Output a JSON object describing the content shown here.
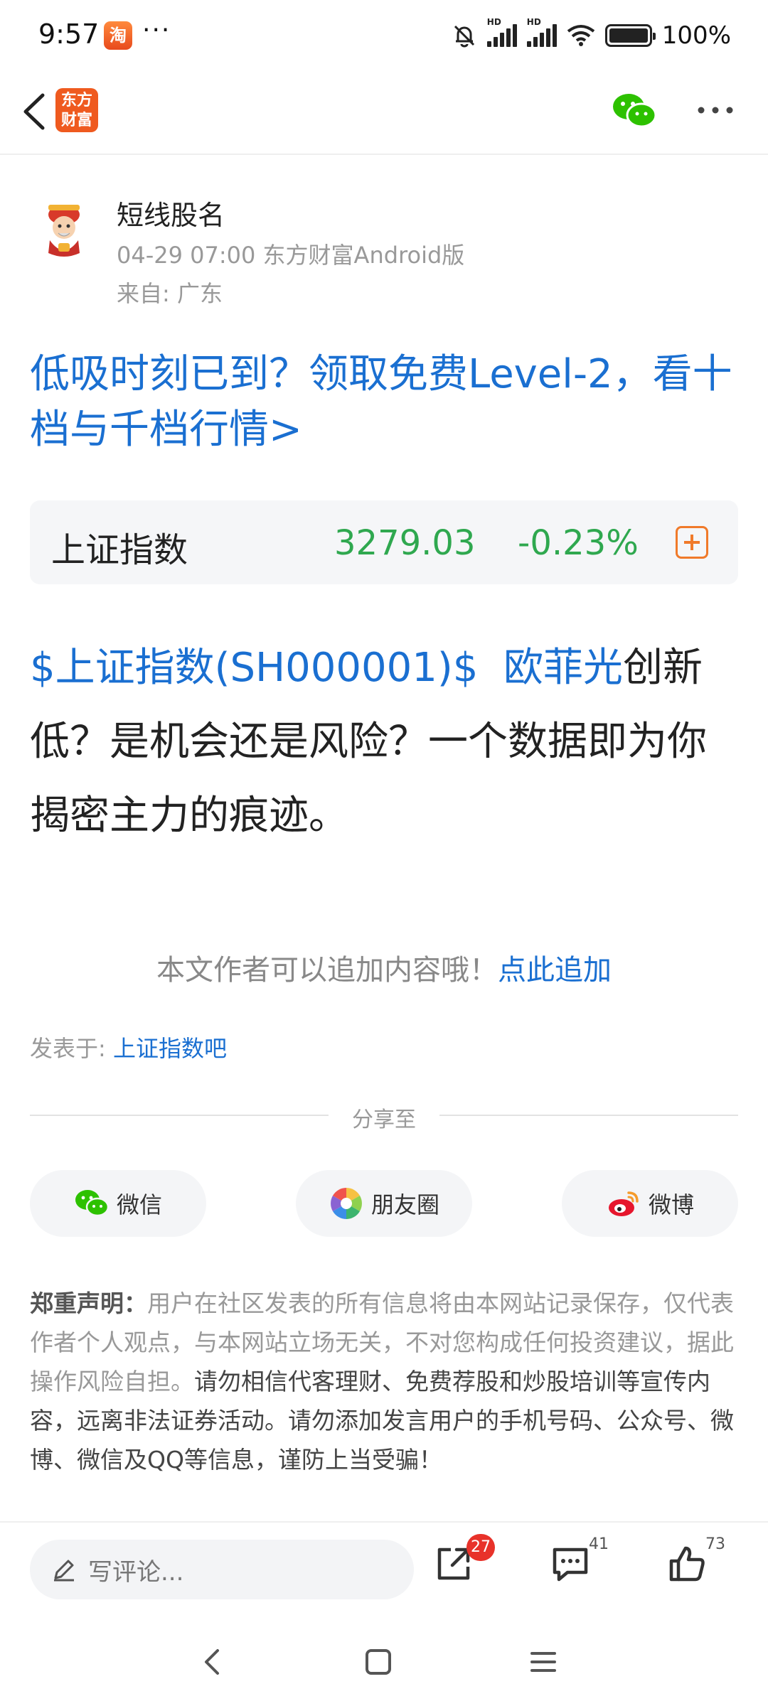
{
  "status_bar": {
    "time": "9:57",
    "app_icon_char": "淘",
    "dots": "···",
    "hd1": "HD",
    "hd2": "HD",
    "battery_percent": "100%"
  },
  "nav": {
    "logo_text": "东方财富"
  },
  "author": {
    "name": "短线股名",
    "meta": "04-29 07:00 东方财富Android版",
    "from": "来自: 广东"
  },
  "promo_headline": "低吸时刻已到？领取免费Level-2，看十档与千档行情>",
  "index_card": {
    "name": "上证指数",
    "value": "3279.03",
    "change": "-0.23%",
    "accent": "#2fa84f"
  },
  "post": {
    "link1": "$上证指数(SH000001)$",
    "link2": "欧菲光",
    "text": "创新低？是机会还是风险？一个数据即为你揭密主力的痕迹。"
  },
  "append_hint": {
    "text": "本文作者可以追加内容哦！",
    "link": "点此追加"
  },
  "posted_in": {
    "label": "发表于: ",
    "link": "上证指数吧"
  },
  "share": {
    "title": "分享至",
    "buttons": [
      {
        "label": "微信",
        "icon": "wechat-icon"
      },
      {
        "label": "朋友圈",
        "icon": "moments-icon"
      },
      {
        "label": "微博",
        "icon": "weibo-icon"
      }
    ]
  },
  "disclaimer": {
    "title": "郑重声明：",
    "text1": "用户在社区发表的所有信息将由本网站记录保存，仅代表作者个人观点，与本网站立场无关，不对您构成任何投资建议，据此操作风险自担。",
    "text2": "请勿相信代客理财、免费荐股和炒股培训等宣传内容，远离非法证券活动。请勿添加发言用户的手机号码、公众号、微博、微信及QQ等信息，谨防上当受骗！"
  },
  "action_bar": {
    "comment_placeholder": "写评论...",
    "share_count": "27",
    "comment_count": "41",
    "like_count": "73"
  },
  "colors": {
    "link": "#1a6fd1",
    "brand": "#ef5a1f",
    "badge": "#e8322a"
  }
}
